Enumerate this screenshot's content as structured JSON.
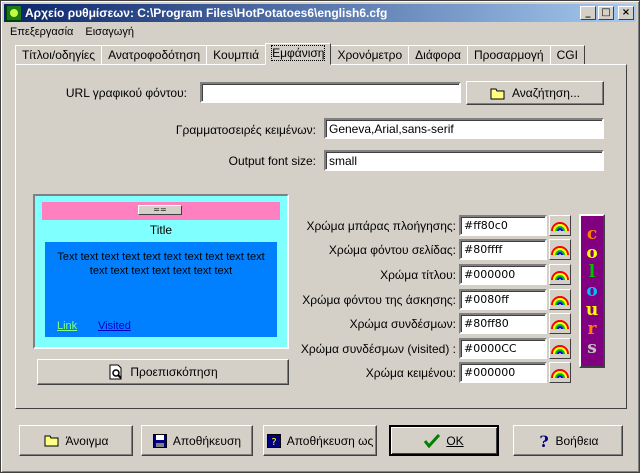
{
  "window": {
    "title": "Αρχείο ρυθμίσεων:  C:\\Program Files\\HotPotatoes6\\english6.cfg"
  },
  "menu": [
    "Επεξεργασία",
    "Εισαγωγή"
  ],
  "tabs": [
    "Τίτλοι/οδηγίες",
    "Ανατροφοδότηση",
    "Κουμπιά",
    "Εμφάνιση",
    "Χρονόμετρο",
    "Διάφορα",
    "Προσαρμογή",
    "CGI"
  ],
  "active_tab": 3,
  "fields": {
    "bg_image_label": "URL γραφικού φόντου:",
    "bg_image_value": "",
    "browse_label": "Αναζήτηση...",
    "fonts_label": "Γραμματοσειρές κειμένων:",
    "fonts_value": "Geneva,Arial,sans-serif",
    "font_size_label": "Output font size:",
    "font_size_value": "small"
  },
  "preview": {
    "nav_button": "==",
    "title": "Title",
    "text": "Text text text text text text text text text text text text text text text text text",
    "link": "Link",
    "visited": "Visited",
    "preview_button": "Προεπισκόπηση"
  },
  "colors": [
    {
      "label": "Χρώμα μπάρας πλοήγησης:",
      "value": "#ff80c0"
    },
    {
      "label": "Χρώμα φόντου σελίδας:",
      "value": "#80ffff"
    },
    {
      "label": "Χρώμα τίτλου:",
      "value": "#000000"
    },
    {
      "label": "Χρώμα φόντου της άσκησης:",
      "value": "#0080ff"
    },
    {
      "label": "Χρώμα συνδέσμων:",
      "value": "#80ff80"
    },
    {
      "label": "Χρώμα συνδέσμων (visited) :",
      "value": "#0000CC"
    },
    {
      "label": "Χρώμα κειμένου:",
      "value": "#000000"
    }
  ],
  "colours_button": {
    "letters": [
      "c",
      "o",
      "l",
      "o",
      "u",
      "r",
      "s"
    ],
    "letter_colors": [
      "#ff8000",
      "#ffff00",
      "#00c000",
      "#00c0ff",
      "#ffff00",
      "#ff8000",
      "#c0c0c0"
    ]
  },
  "buttons": {
    "open": "Άνοιγμα",
    "save": "Αποθήκευση",
    "save_as": "Αποθήκευση ως",
    "ok": "OK",
    "help": "Βοήθεια"
  }
}
